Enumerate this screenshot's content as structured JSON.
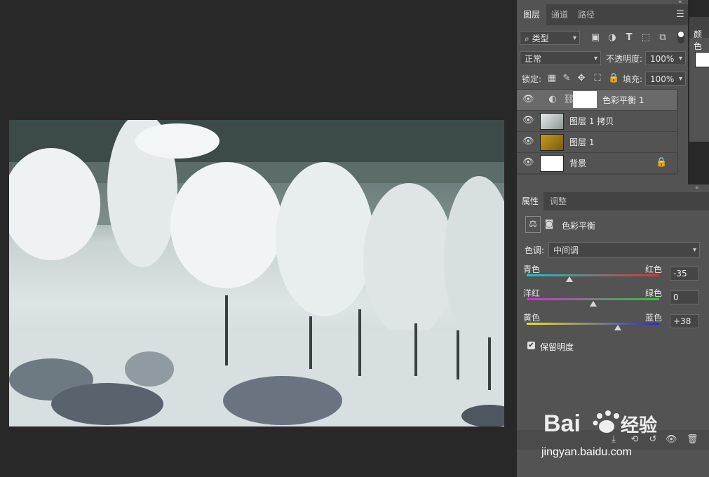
{
  "layers_panel": {
    "tabs": [
      "图层",
      "通道",
      "路径"
    ],
    "filter_label": "类型",
    "blend_mode": "正常",
    "opacity_label": "不透明度:",
    "opacity_value": "100%",
    "lock_label": "锁定:",
    "fill_label": "填充:",
    "fill_value": "100%",
    "layers": [
      {
        "name": "色彩平衡 1",
        "type": "adjustment"
      },
      {
        "name": "图层 1 拷贝",
        "type": "image"
      },
      {
        "name": "图层 1",
        "type": "image"
      },
      {
        "name": "背景",
        "type": "background"
      }
    ]
  },
  "color_panel": {
    "tab": "颜色"
  },
  "properties_panel": {
    "tabs": [
      "属性",
      "调整"
    ],
    "title": "色彩平衡",
    "tone_label": "色调:",
    "tone_value": "中间调",
    "sliders": [
      {
        "left": "青色",
        "right": "红色",
        "value": "-35",
        "fraction": 0.325
      },
      {
        "left": "洋红",
        "right": "绿色",
        "value": "0",
        "fraction": 0.5
      },
      {
        "left": "黄色",
        "right": "蓝色",
        "value": "+38",
        "fraction": 0.69
      }
    ],
    "preserve_luminosity": "保留明度"
  },
  "watermark": {
    "brand": "Baidu经验",
    "url": "jingyan.baidu.com"
  },
  "colors": {
    "panel_bg": "#535353",
    "tab_bg": "#434343",
    "workspace_bg": "#282828",
    "selected_layer": "#6a6a6a"
  }
}
